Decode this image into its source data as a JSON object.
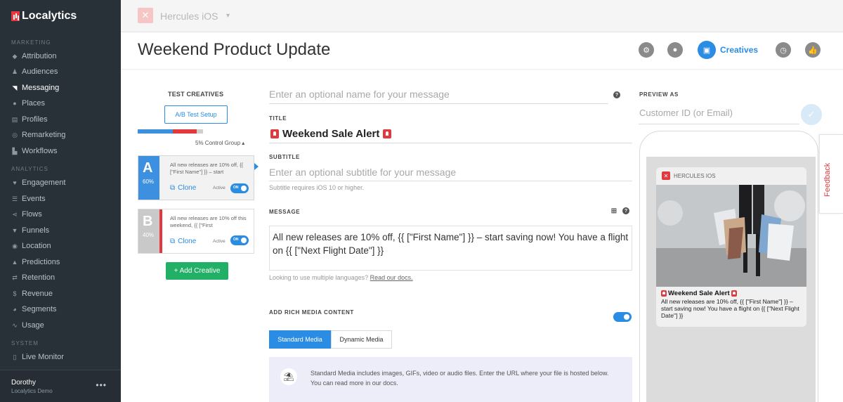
{
  "brand": {
    "logo_text": "Localytics",
    "accent": "#2a8ce3",
    "danger": "#e0393e",
    "success": "#22b066"
  },
  "sidebar": {
    "sections": [
      {
        "title": "MARKETING",
        "items": [
          {
            "label": "Attribution",
            "icon": "tag-icon"
          },
          {
            "label": "Audiences",
            "icon": "people-icon"
          },
          {
            "label": "Messaging",
            "icon": "chat-icon",
            "active": true
          },
          {
            "label": "Places",
            "icon": "pin-icon"
          },
          {
            "label": "Profiles",
            "icon": "id-card-icon"
          },
          {
            "label": "Remarketing",
            "icon": "target-icon"
          },
          {
            "label": "Workflows",
            "icon": "workflow-icon"
          }
        ]
      },
      {
        "title": "ANALYTICS",
        "items": [
          {
            "label": "Engagement",
            "icon": "heart-icon"
          },
          {
            "label": "Events",
            "icon": "list-icon"
          },
          {
            "label": "Flows",
            "icon": "flow-icon"
          },
          {
            "label": "Funnels",
            "icon": "funnel-icon"
          },
          {
            "label": "Location",
            "icon": "globe-icon"
          },
          {
            "label": "Predictions",
            "icon": "flask-icon"
          },
          {
            "label": "Retention",
            "icon": "retention-icon"
          },
          {
            "label": "Revenue",
            "icon": "dollar-icon"
          },
          {
            "label": "Segments",
            "icon": "pie-icon"
          },
          {
            "label": "Usage",
            "icon": "pulse-icon"
          }
        ]
      },
      {
        "title": "SYSTEM",
        "items": [
          {
            "label": "Live Monitor",
            "icon": "monitor-icon"
          }
        ]
      }
    ],
    "user": {
      "name": "Dorothy",
      "org": "Localytics Demo",
      "menu": "•••"
    }
  },
  "topbar": {
    "app_name": "Hercules iOS",
    "caret": "▾"
  },
  "header": {
    "title": "Weekend Product Update",
    "active_tab_label": "Creatives"
  },
  "creatives": {
    "heading": "TEST CREATIVES",
    "ab_button": "A/B Test Setup",
    "split": [
      50,
      34,
      9
    ],
    "control_group": "5% Control Group ▴",
    "cards": [
      {
        "letter": "A",
        "pct": "60%",
        "text": "All new releases are 10% off, {{ [\"First Name\"] }} – start",
        "clone": "Clone",
        "active_label": "Active",
        "toggle": "ON",
        "color": "#3d8fe0"
      },
      {
        "letter": "B",
        "pct": "40%",
        "text": "All new releases are 10% off this weekend, {{ [\"First",
        "clone": "Clone",
        "active_label": "Active",
        "toggle": "ON",
        "color": "#c9c9c9"
      }
    ],
    "add_button": "+ Add Creative"
  },
  "form": {
    "name_placeholder": "Enter an optional name for your message",
    "title_label": "TITLE",
    "title_value": "Weekend Sale Alert",
    "subtitle_label": "SUBTITLE",
    "subtitle_placeholder": "Enter an optional subtitle for your message",
    "subtitle_note": "Subtitle requires iOS 10 or higher.",
    "message_label": "MESSAGE",
    "message_value": "All new releases are 10% off, {{ [\"First Name\"] }} – start saving now! You have a flight on {{ [\"Next Flight Date\"] }}",
    "languages_note": "Looking to use multiple languages?",
    "languages_link": "Read our docs.",
    "rich_media_label": "ADD RICH MEDIA CONTENT",
    "tab_standard": "Standard Media",
    "tab_dynamic": "Dynamic Media",
    "info_text": "Standard Media includes images, GIFs, video or audio files. Enter the URL where your file is hosted below. You can read more in our docs."
  },
  "preview": {
    "label": "PREVIEW AS",
    "customer_placeholder": "Customer ID (or Email)",
    "app_label": "HERCULES IOS",
    "notif_title": "Weekend Sale Alert",
    "notif_body": "All new releases are 10% off, {{ [\"First Name\"] }} – start saving now! You have a flight on {{ [\"Next Flight Date\"] }}"
  },
  "feedback": {
    "label": "Feedback"
  }
}
